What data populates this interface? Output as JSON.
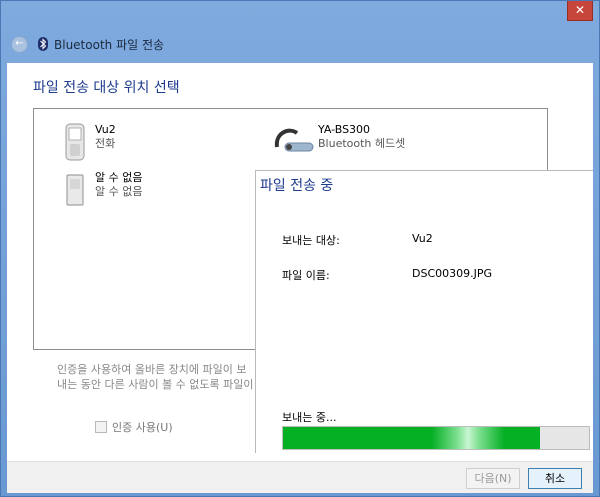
{
  "window": {
    "title": "Bluetooth 파일 전송",
    "close_glyph": "✕",
    "back_glyph": "←"
  },
  "main": {
    "heading": "파일 전송 대상 위치 선택",
    "devices": [
      {
        "name": "Vu2",
        "type": "전화",
        "icon": "phone-icon"
      },
      {
        "name": "YA-BS300",
        "type": "Bluetooth 헤드셋",
        "icon": "headset-icon"
      },
      {
        "name": "알 수 없음",
        "type": "알 수 없음",
        "icon": "unknown-device-icon"
      }
    ],
    "hint_line1": "인증을 사용하여 올바른 장치에 파일이 보",
    "hint_line2": "내는 동안 다른 사람이 볼 수 없도록 파일이",
    "auth_label": "인증 사용(U)"
  },
  "footer": {
    "next_label": "다음(N)",
    "cancel_label": "취소"
  },
  "progress": {
    "title": "파일 전송 중",
    "to_label": "보내는 대상:",
    "to_value": "Vu2",
    "file_label": "파일 이름:",
    "file_value": "DSC00309.JPG",
    "status": "보내는 중...",
    "fraction": 0.84,
    "color": "#06b025"
  }
}
